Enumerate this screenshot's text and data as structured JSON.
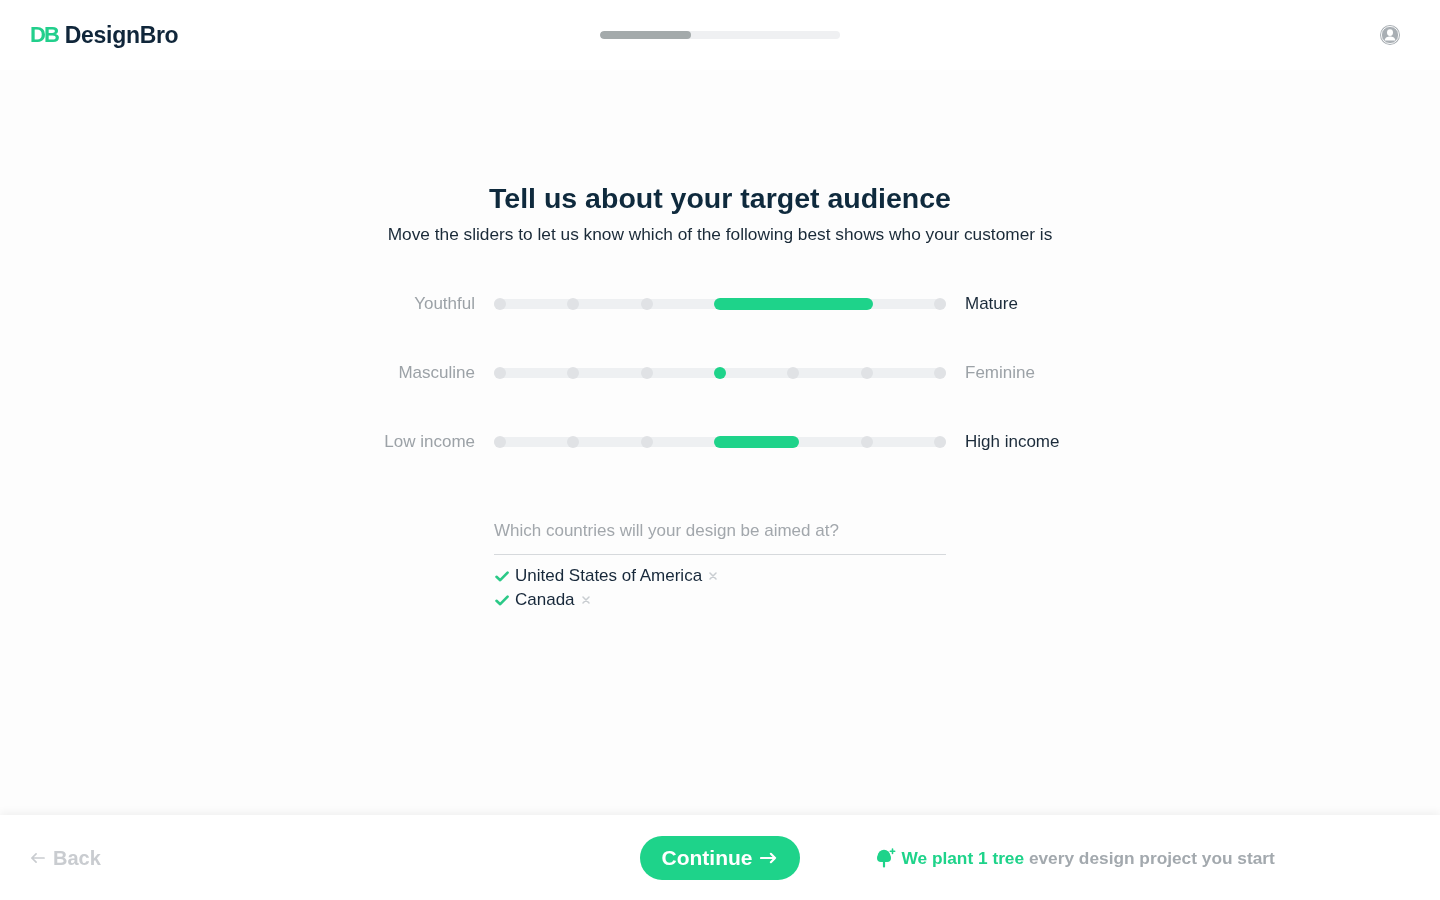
{
  "header": {
    "logo": {
      "mark": "DB",
      "name": "DesignBro"
    },
    "progress": {
      "level": 0.38
    }
  },
  "title": "Tell us about your target audience",
  "subtitle": "Move the sliders to let us know which of the following best shows who your customer is",
  "sliders": [
    {
      "left": {
        "text": "Youthful",
        "highlighted": false
      },
      "right": {
        "text": "Mature",
        "highlighted": true
      },
      "stops": [
        {
          "selected": false
        },
        {
          "selected": false
        },
        {
          "selected": false
        },
        {
          "selected": true
        },
        {
          "selected": true
        },
        {
          "selected": true
        },
        {
          "selected": false
        }
      ]
    },
    {
      "left": {
        "text": "Masculine",
        "highlighted": false
      },
      "right": {
        "text": "Feminine",
        "highlighted": false
      },
      "stops": [
        {
          "selected": false
        },
        {
          "selected": false
        },
        {
          "selected": false
        },
        {
          "selected": true
        },
        {
          "selected": false
        },
        {
          "selected": false
        },
        {
          "selected": false
        }
      ]
    },
    {
      "left": {
        "text": "Low income",
        "highlighted": false
      },
      "right": {
        "text": "High income",
        "highlighted": true
      },
      "stops": [
        {
          "selected": false
        },
        {
          "selected": false
        },
        {
          "selected": false
        },
        {
          "selected": true
        },
        {
          "selected": true
        },
        {
          "selected": false
        },
        {
          "selected": false
        }
      ]
    }
  ],
  "countries": {
    "placeholder": "Which countries will your design be aimed at?",
    "chosen": [
      {
        "name": "United States of America",
        "checked": true
      },
      {
        "name": "Canada",
        "checked": true
      }
    ]
  },
  "footer": {
    "back": {
      "label": "Back",
      "disabled": true
    },
    "continue": {
      "label": "Continue"
    },
    "note": "**We plant 1 tree** every design project you start"
  }
}
